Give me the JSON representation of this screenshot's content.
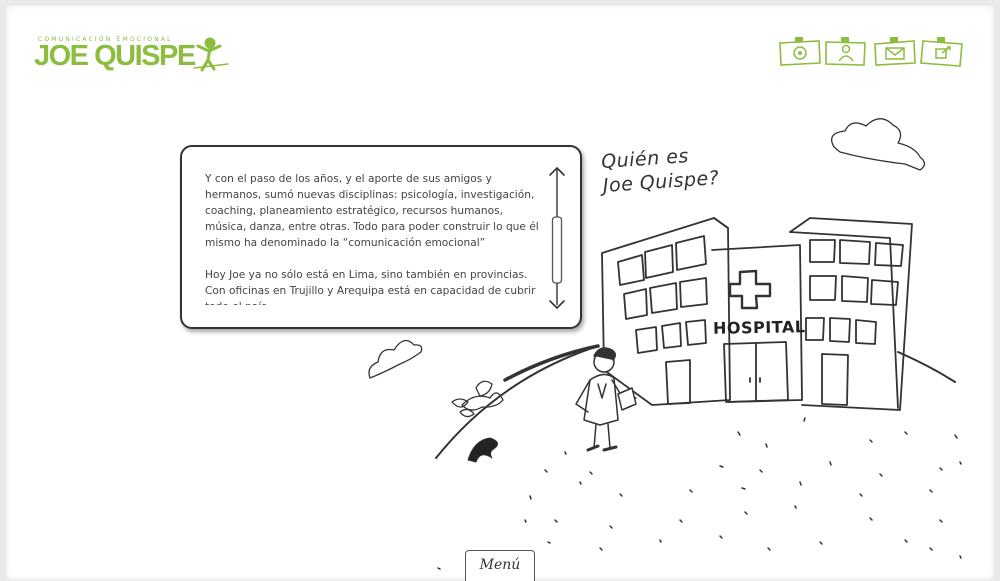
{
  "logo": {
    "tagline": "COMUNICACIÓN EMOCIONAL",
    "name": "JOE QUISPE",
    "brand_color": "#8dbd3f"
  },
  "nav": {
    "items": [
      {
        "icon": "home-icon"
      },
      {
        "icon": "person-icon"
      },
      {
        "icon": "envelope-icon"
      },
      {
        "icon": "share-icon"
      }
    ]
  },
  "textbox": {
    "paragraph_1": "Y con el paso de los años, y el aporte de sus amigos y hermanos, sumó nuevas disciplinas: psicología, investigación, coaching, planeamiento estratégico, recursos humanos, música, danza, entre otras. Todo para poder construir lo que él mismo ha denominado la “comunicación emocional”",
    "paragraph_2": "Hoy Joe ya no sólo está en Lima, sino también en provincias. Con oficinas en Trujillo y Arequipa está en capacidad de cubrir todo el país."
  },
  "heading": {
    "line_1": "Quién es",
    "line_2": "Joe Quispe?"
  },
  "hospital_sign": "HOSPITAL",
  "menu": {
    "label": "Menú"
  }
}
